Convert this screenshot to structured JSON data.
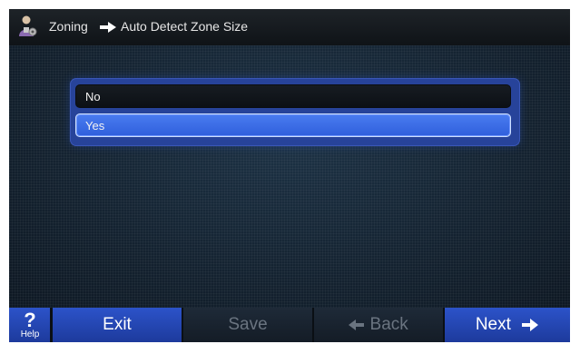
{
  "header": {
    "icon": "user-settings-icon",
    "breadcrumb": [
      "Zoning",
      "Auto Detect Zone Size"
    ],
    "separator_icon": "arrow-right-icon"
  },
  "options": [
    {
      "label": "No",
      "selected": false
    },
    {
      "label": "Yes",
      "selected": true
    }
  ],
  "footer": {
    "help": {
      "symbol": "?",
      "label": "Help",
      "icon": "help-icon"
    },
    "exit_label": "Exit",
    "save_label": "Save",
    "back_label": "Back",
    "back_icon": "arrow-left-icon",
    "next_label": "Next",
    "next_icon": "arrow-right-icon"
  },
  "colors": {
    "accent": "#2c53c9",
    "selected_option": "#3a6ae6",
    "disabled_text": "#6a7480"
  }
}
